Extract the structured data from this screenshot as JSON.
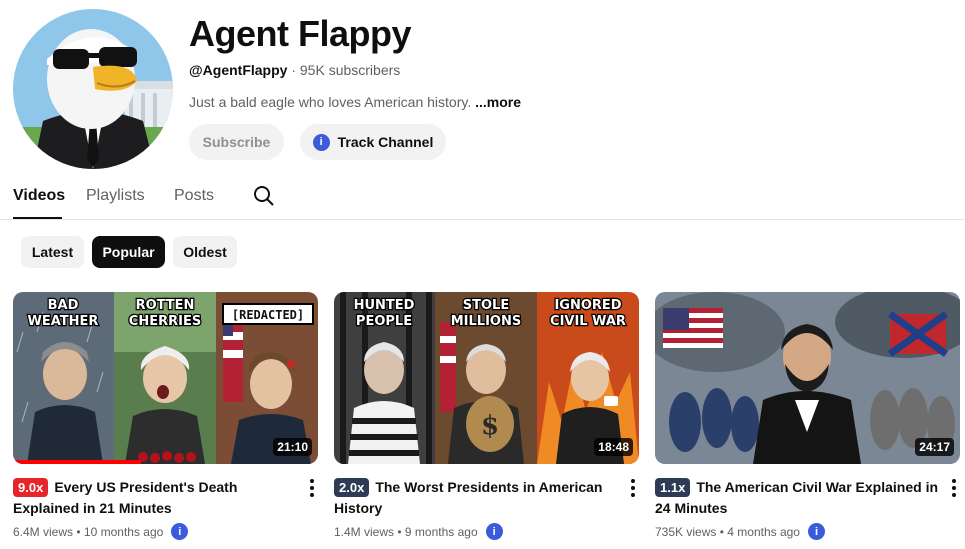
{
  "channel": {
    "name": "Agent Flappy",
    "handle": "@AgentFlappy",
    "separator": "·",
    "subscribers": "95K subscribers",
    "description": "Just a bald eagle who loves American history.",
    "more": "...more",
    "subscribe_label": "Subscribe",
    "track_label": "Track Channel"
  },
  "tabs": [
    "Videos",
    "Playlists",
    "Posts"
  ],
  "chips": [
    "Latest",
    "Popular",
    "Oldest"
  ],
  "videos": [
    {
      "multiplier": "9.0x",
      "multiplier_color": "#e5252a",
      "title": "Every US President's Death Explained in 21 Minutes",
      "views": "6.4M views",
      "age": "10 months ago",
      "duration": "21:10",
      "watched_fraction": 0.42,
      "thumb_labels": [
        "BAD\nWEATHER",
        "ROTTEN\nCHERRIES",
        "[REDACTED]"
      ]
    },
    {
      "multiplier": "2.0x",
      "multiplier_color": "#2f3a55",
      "title": "The Worst Presidents in American History",
      "views": "1.4M views",
      "age": "9 months ago",
      "duration": "18:48",
      "thumb_labels": [
        "HUNTED\nPEOPLE",
        "STOLE\nMILLIONS",
        "IGNORED\nCIVIL WAR"
      ]
    },
    {
      "multiplier": "1.1x",
      "multiplier_color": "#2f3a55",
      "title": "The American Civil War Explained in 24 Minutes",
      "views": "735K views",
      "age": "4 months ago",
      "duration": "24:17"
    }
  ],
  "bullet": "•",
  "info_glyph": "i",
  "colors": {
    "accent_blue": "#3b5bdb",
    "progress_red": "#ff0000"
  }
}
